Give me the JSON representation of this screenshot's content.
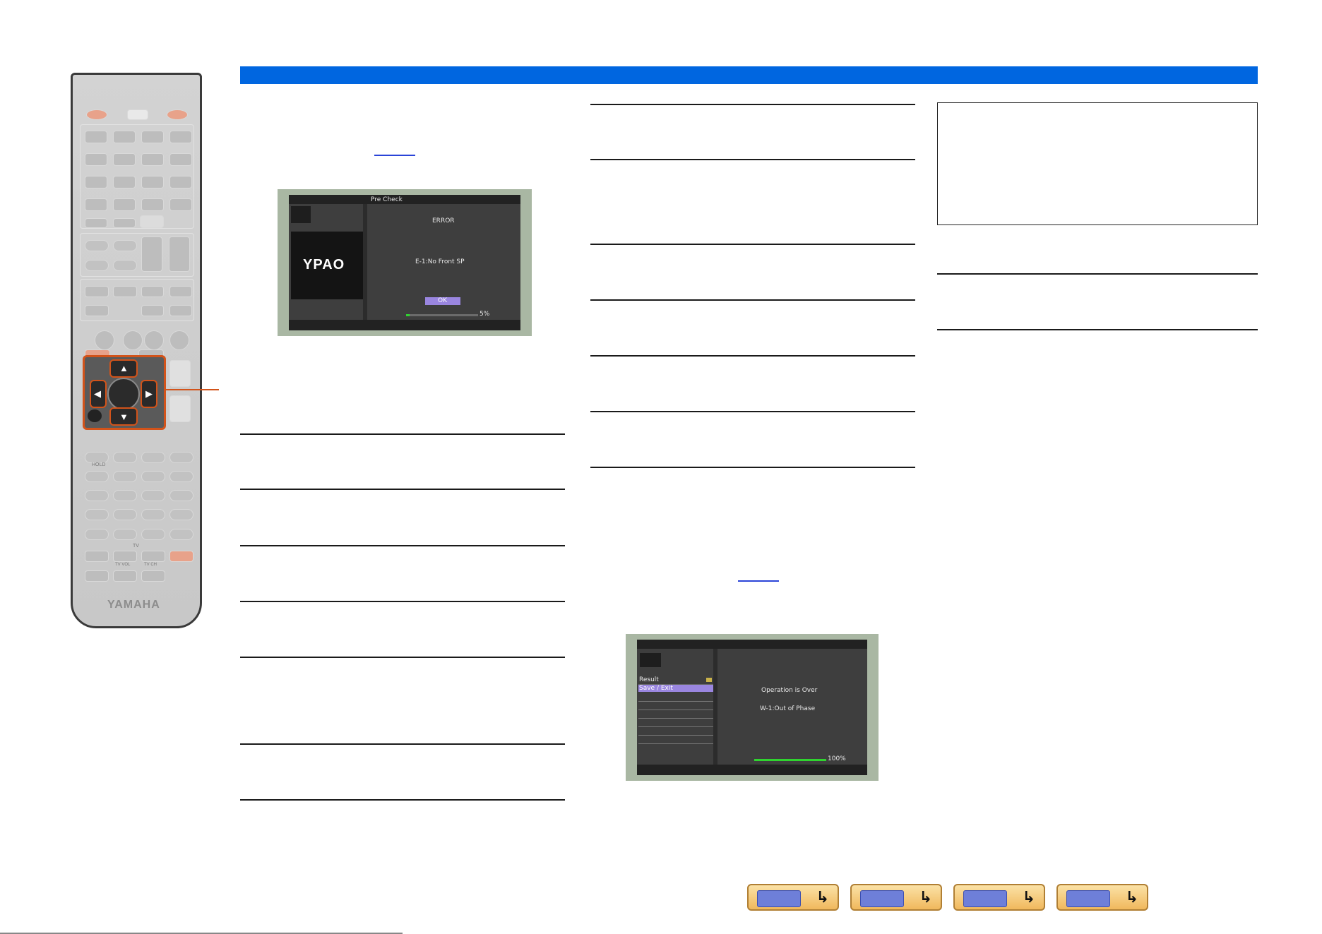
{
  "remote": {
    "brand": "YAMAHA",
    "labels": {
      "hold": "HOLD",
      "tv": "TV",
      "tv_vol": "TV VOL",
      "tv_ch": "TV CH"
    }
  },
  "screen1": {
    "title": "Pre Check",
    "logo": "YPAO",
    "error_label": "ERROR",
    "message": "E-1:No Front SP",
    "ok_button": "OK",
    "progress": 0.05,
    "progress_label": "5%"
  },
  "screen2": {
    "menu": [
      "Result",
      "Save / Exit"
    ],
    "message": "Operation is Over",
    "warning": "W-1:Out of Phase",
    "progress": 1.0,
    "progress_label": "100%"
  },
  "nav_buttons": [
    {
      "icon": "receiver-front-icon"
    },
    {
      "icon": "receiver-rear-icon"
    },
    {
      "icon": "menu-tree-icon"
    },
    {
      "icon": "remote-icon"
    }
  ],
  "colors": {
    "header_bar": "#0066e0",
    "highlight": "#d2531a",
    "menu_selected": "#9a86e0"
  }
}
